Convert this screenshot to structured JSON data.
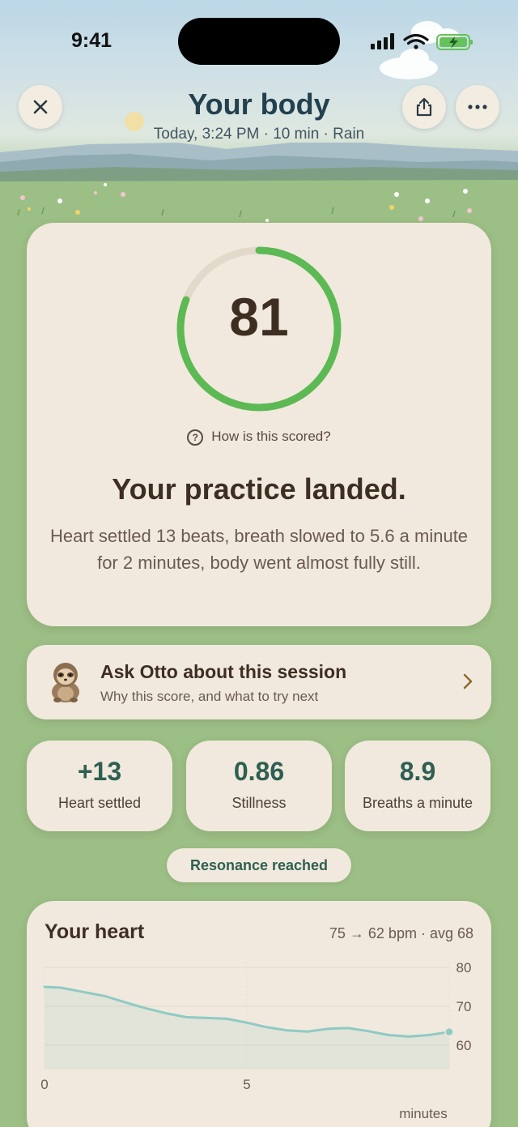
{
  "status_bar": {
    "time": "9:41"
  },
  "header": {
    "title": "Your body",
    "subtitle": "Today, 3:24 PM · 10 min · Rain"
  },
  "score": {
    "value": "81",
    "fraction": 0.81,
    "how_label": "How is this scored?",
    "headline": "Your practice landed.",
    "description": "Heart settled 13 beats, breath slowed to 5.6 a minute for 2 minutes, body went almost fully still."
  },
  "otto": {
    "title": "Ask Otto about this session",
    "subtitle": "Why this score, and what to try next"
  },
  "stats": [
    {
      "value": "+13",
      "label": "Heart settled"
    },
    {
      "value": "0.86",
      "label": "Stillness"
    },
    {
      "value": "8.9",
      "label": "Breaths a minute"
    }
  ],
  "resonance_label": "Resonance reached",
  "heart": {
    "title": "Your heart",
    "meta": "75 → 62 bpm · avg 68"
  },
  "chart_data": {
    "type": "line",
    "title": "Your heart",
    "xlabel": "minutes",
    "ylabel": "",
    "x_ticks": [
      "0",
      "5"
    ],
    "y_ticks": [
      "80",
      "70",
      "60"
    ],
    "xlim": [
      0,
      10
    ],
    "ylim": [
      60,
      80
    ],
    "grid": true,
    "series": [
      {
        "x": [
          0,
          0.4,
          0.8,
          1.5,
          2,
          2.5,
          3,
          3.5,
          4,
          4.5,
          5,
          5.5,
          6,
          6.5,
          7,
          7.5,
          8,
          8.5,
          9,
          9.5,
          10
        ],
        "y": [
          75,
          74.8,
          74,
          72.6,
          71,
          69.5,
          68.2,
          67.2,
          67,
          66.8,
          65.8,
          64.6,
          63.8,
          63.5,
          64.2,
          64.4,
          63.6,
          62.6,
          62.2,
          62.6,
          63.4
        ]
      }
    ]
  },
  "colors": {
    "accent_green": "#5cb954",
    "stat_teal": "#2e5f52",
    "chart_line": "#8fcac4",
    "card_bg": "#f1e9dd",
    "field_green": "#9cbf86"
  }
}
